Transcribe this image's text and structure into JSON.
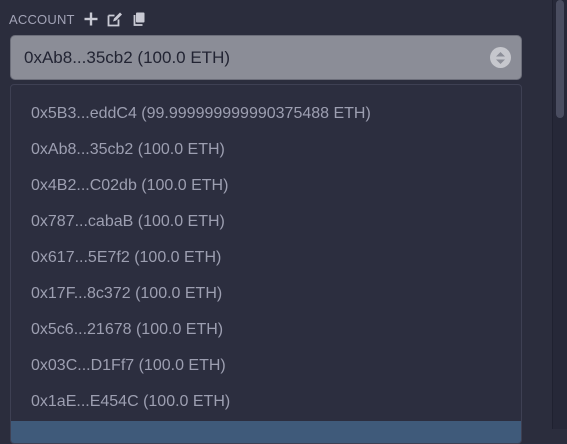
{
  "account": {
    "label": "ACCOUNT",
    "icons": [
      "plus-icon",
      "edit-icon",
      "copy-icon"
    ]
  },
  "select": {
    "value": "0xAb8...35cb2 (100.0 ETH)"
  },
  "options": [
    "0x5B3...eddC4 (99.999999999990375488 ETH)",
    "0xAb8...35cb2 (100.0 ETH)",
    "0x4B2...C02db (100.0 ETH)",
    "0x787...cabaB (100.0 ETH)",
    "0x617...5E7f2 (100.0 ETH)",
    "0x17F...8c372 (100.0 ETH)",
    "0x5c6...21678 (100.0 ETH)",
    "0x03C...D1Ff7 (100.0 ETH)",
    "0x1aE...E454C (100.0 ETH)",
    ""
  ],
  "colors": {
    "background": "#2b2d3d",
    "select_bg": "#8b8d97",
    "highlight": "#3f5a7a",
    "option_text": "#9d9fb1"
  }
}
